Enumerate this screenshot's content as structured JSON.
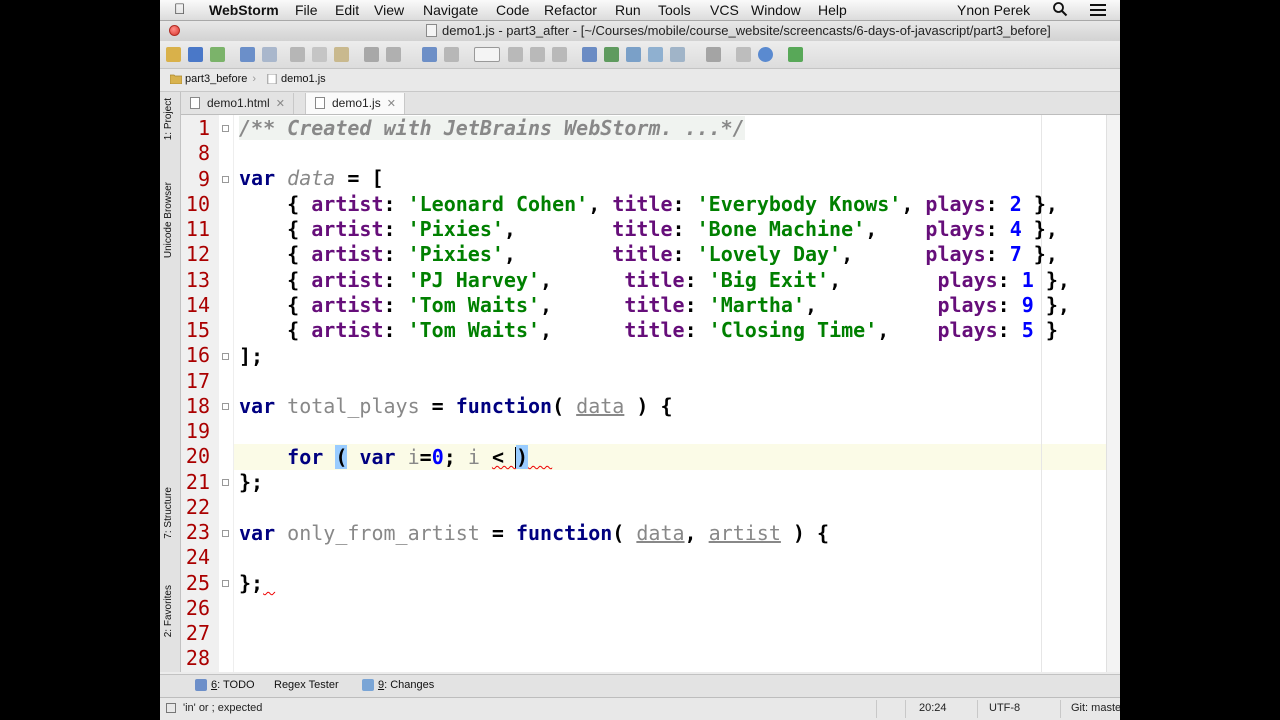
{
  "menubar": {
    "app_name": "WebStorm",
    "items": [
      "File",
      "Edit",
      "View",
      "Navigate",
      "Code",
      "Refactor",
      "Run",
      "Tools",
      "VCS",
      "Window",
      "Help"
    ],
    "user": "Ynon Perek"
  },
  "window": {
    "title": "demo1.js - part3_after - [~/Courses/mobile/course_website/screencasts/6-days-of-javascript/part3_before]"
  },
  "breadcrumbs": [
    "part3_before",
    "demo1.js"
  ],
  "left_tool_windows": [
    "1: Project",
    "Unicode Browser",
    "7: Structure",
    "2: Favorites"
  ],
  "editor_tabs": [
    {
      "label": "demo1.html",
      "active": false
    },
    {
      "label": "demo1.js",
      "active": true
    }
  ],
  "editor": {
    "line_numbers": [
      "1",
      "8",
      "9",
      "10",
      "11",
      "12",
      "13",
      "14",
      "15",
      "16",
      "17",
      "18",
      "19",
      "20",
      "21",
      "22",
      "23",
      "24",
      "25",
      "26",
      "27",
      "28"
    ],
    "current_line": "20",
    "code": {
      "l1": "/** Created with JetBrains WebStorm. ...*/",
      "l9_kw": "var",
      "l9_name": "data",
      "l9_rest": " = [",
      "rows": [
        {
          "artist": "'Leonard Cohen'",
          "pad1": ", ",
          "title": "'Everybody Knows'",
          "pad2": ", ",
          "plays": "2",
          "end": " },"
        },
        {
          "artist": "'Pixies'",
          "pad1": ",        ",
          "title": "'Bone Machine'",
          "pad2": ",    ",
          "plays": "4",
          "end": " },"
        },
        {
          "artist": "'Pixies'",
          "pad1": ",        ",
          "title": "'Lovely Day'",
          "pad2": ",      ",
          "plays": "7",
          "end": " },"
        },
        {
          "artist": "'PJ Harvey'",
          "pad1": ",      ",
          "title": "'Big Exit'",
          "pad2": ",        ",
          "plays": "1",
          "end": " },"
        },
        {
          "artist": "'Tom Waits'",
          "pad1": ",      ",
          "title": "'Martha'",
          "pad2": ",          ",
          "plays": "9",
          "end": " },"
        },
        {
          "artist": "'Tom Waits'",
          "pad1": ",      ",
          "title": "'Closing Time'",
          "pad2": ",    ",
          "plays": "5",
          "end": " }"
        }
      ],
      "key_artist": "artist",
      "key_title": "title",
      "key_plays": "plays",
      "l16": "];",
      "l18_name": "total_plays",
      "function_kw": "function",
      "l18_param": "data",
      "l20_for": "for",
      "l20_var": "var",
      "l20_i": "i",
      "l20_zero": "0",
      "l20_i2": "i",
      "l21": "};",
      "l23_name": "only_from_artist",
      "l23_param1": "data",
      "l23_param2": "artist",
      "l25": "};"
    }
  },
  "tool_windows": [
    {
      "key": "6",
      "label": ": TODO"
    },
    {
      "key": "",
      "label": "Regex Tester"
    },
    {
      "key": "9",
      "label": ": Changes"
    }
  ],
  "status": {
    "message": "'in' or ; expected",
    "position": "20:24",
    "encoding": "UTF-8",
    "vcs": "Git: master"
  },
  "colors": {
    "keyword": "#000080",
    "string": "#008000",
    "property": "#660e7a",
    "number": "#0000ff",
    "line_number": "#aa0000",
    "current_line_bg": "#fbfbe7"
  }
}
